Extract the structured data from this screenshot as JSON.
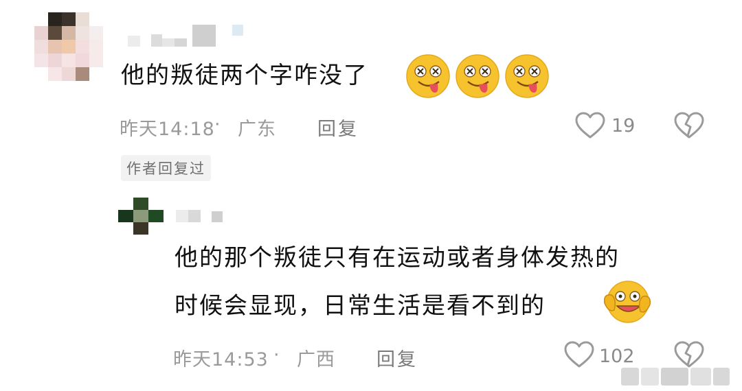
{
  "comment": {
    "text": "他的叛徒两个字咋没了",
    "time": "昨天14:18",
    "sep": "·",
    "location": "广东",
    "reply_label": "回复",
    "like_count": "19",
    "emoji_name": "drooling-face-icon"
  },
  "author_tag": "作者回复过",
  "reply": {
    "text_line1": "他的那个叛徒只有在运动或者身体发热的",
    "text_line2": "时候会显现，日常生活是看不到的",
    "time": "昨天14:53",
    "sep": "·",
    "location": "广西",
    "reply_label": "回复",
    "like_count": "102",
    "emoji_name": "hugging-face-icon"
  },
  "colors": {
    "meta_gray": "#9a9a9a",
    "text": "#111111",
    "emoji_yellow": "#f6c22e",
    "tongue": "#e6505a"
  }
}
